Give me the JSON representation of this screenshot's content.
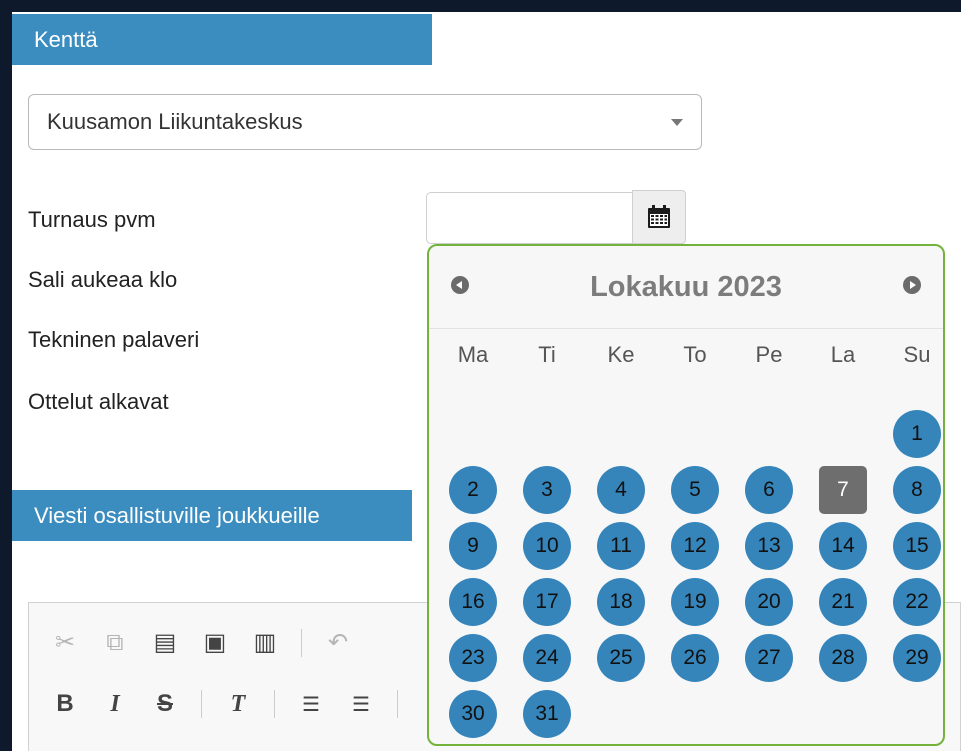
{
  "form": {
    "field_header": "Kenttä",
    "venue_select": "Kuusamon Liikuntakeskus",
    "labels": {
      "date": "Turnaus pvm",
      "hall_opens": "Sali aukeaa klo",
      "tech_meeting": "Tekninen palaveri",
      "matches_start": "Ottelut alkavat"
    },
    "date_value": "",
    "message_header": "Viesti osallistuville joukkueille"
  },
  "datepicker": {
    "title": "Lokakuu 2023",
    "weekdays": [
      "Ma",
      "Ti",
      "Ke",
      "To",
      "Pe",
      "La",
      "Su"
    ],
    "days": [
      "1",
      "2",
      "3",
      "4",
      "5",
      "6",
      "7",
      "8",
      "9",
      "10",
      "11",
      "12",
      "13",
      "14",
      "15",
      "16",
      "17",
      "18",
      "19",
      "20",
      "21",
      "22",
      "23",
      "24",
      "25",
      "26",
      "27",
      "28",
      "29",
      "30",
      "31"
    ],
    "first_weekday_index": 6,
    "highlighted_day": "7",
    "day_color": "#3585bb",
    "highlight_color": "#6e6e6e",
    "border_color": "#74b33b"
  },
  "editor_toolbar": {
    "row1": [
      {
        "name": "cut-icon",
        "glyph": "✂",
        "enabled": false
      },
      {
        "name": "copy-icon",
        "glyph": "⧉",
        "enabled": false
      },
      {
        "name": "paste-icon",
        "glyph": "📋",
        "enabled": true
      },
      {
        "name": "paste-text-icon",
        "glyph": "📋",
        "enabled": true
      },
      {
        "name": "paste-word-icon",
        "glyph": "📋",
        "enabled": true
      },
      {
        "name": "undo-icon",
        "glyph": "↶",
        "enabled": false
      }
    ],
    "row2": [
      {
        "name": "bold-icon",
        "glyph": "B",
        "enabled": true
      },
      {
        "name": "italic-icon",
        "glyph": "I",
        "enabled": true
      },
      {
        "name": "strike-icon",
        "glyph": "S",
        "enabled": true
      },
      {
        "name": "remove-format-icon",
        "glyph": "Tx",
        "enabled": true
      },
      {
        "name": "numbered-list-icon",
        "glyph": "☰",
        "enabled": true
      },
      {
        "name": "bulleted-list-icon",
        "glyph": "☰",
        "enabled": true
      }
    ]
  }
}
